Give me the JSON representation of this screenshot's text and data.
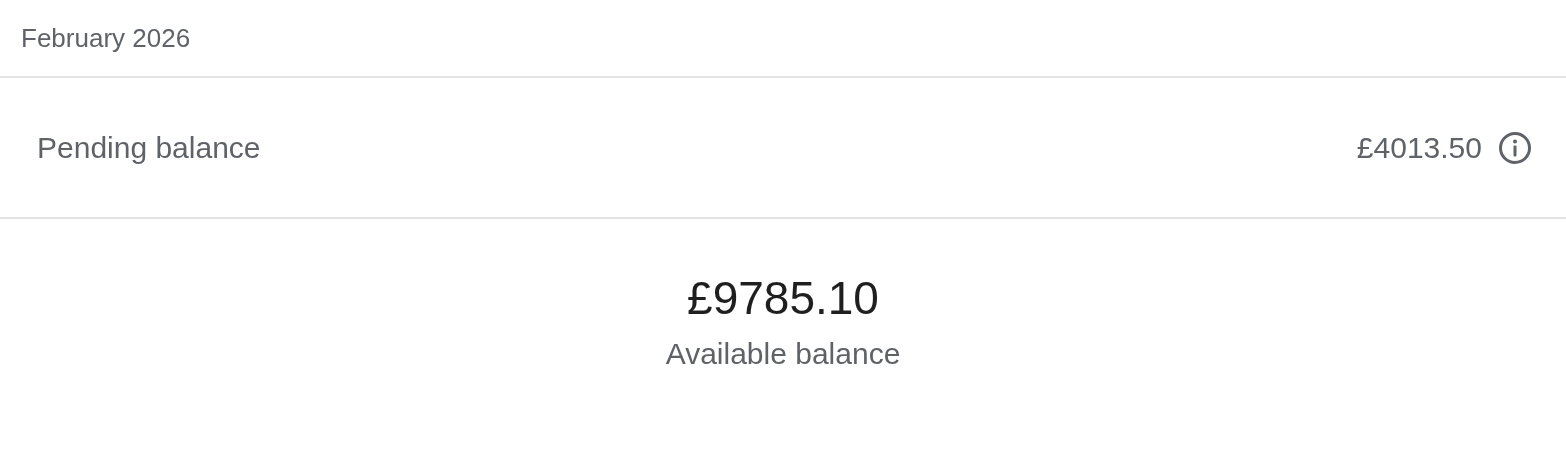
{
  "header": {
    "title": "February 2026"
  },
  "pending": {
    "label": "Pending balance",
    "amount": "£4013.50"
  },
  "available": {
    "amount": "£9785.10",
    "label": "Available balance"
  }
}
